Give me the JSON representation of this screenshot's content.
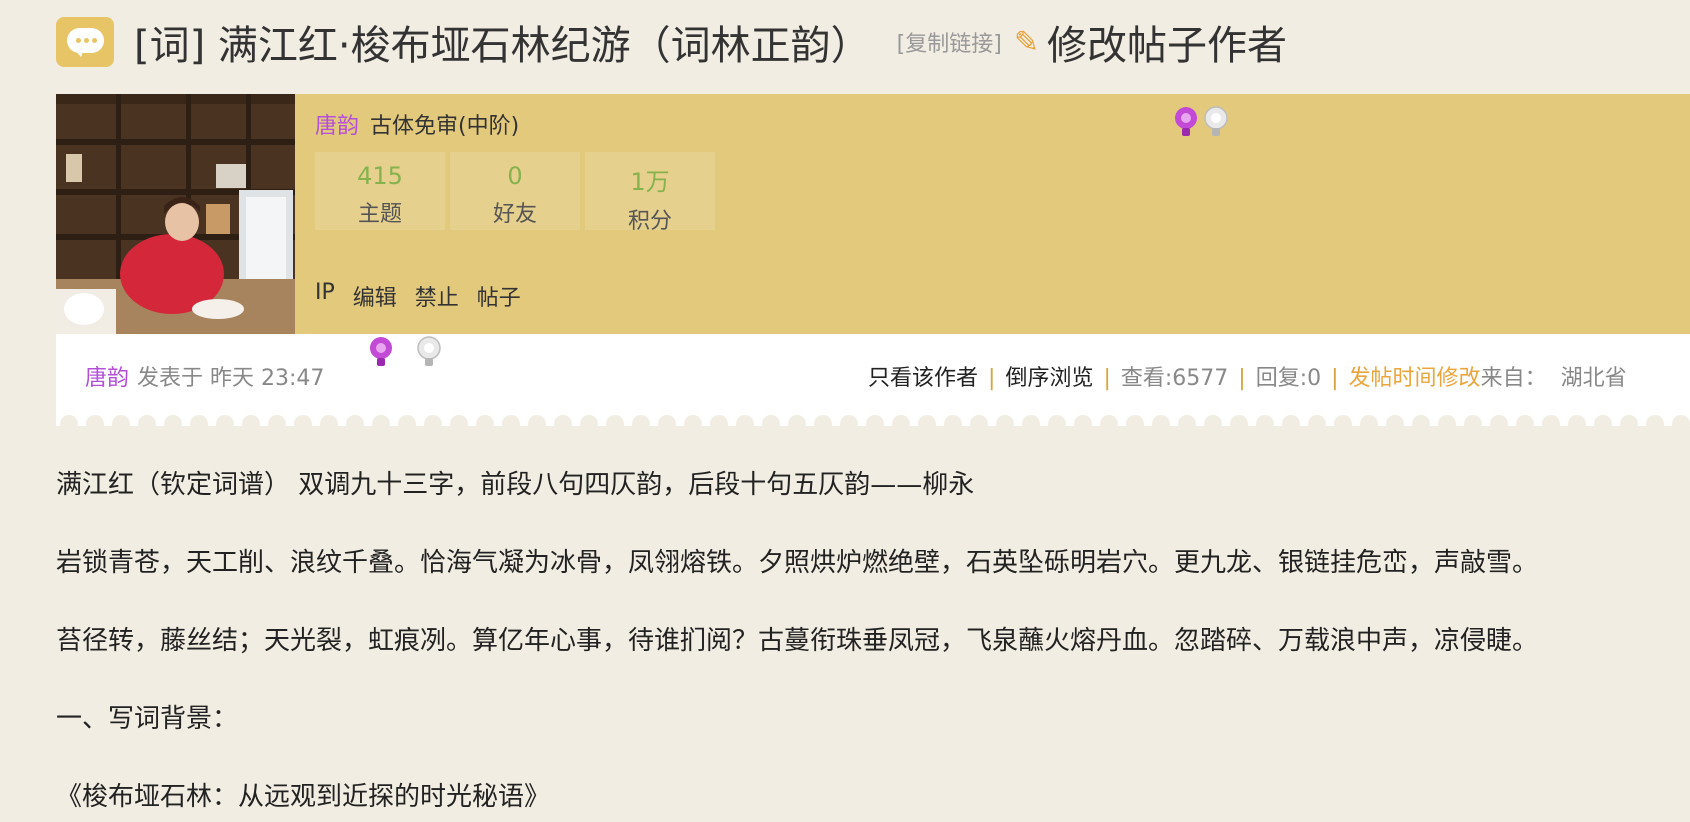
{
  "title": {
    "text": "[词] 满江红·梭布垭石林纪游（词林正韵）",
    "copy_link": "[复制链接]",
    "edit_author": "修改帖子作者"
  },
  "author": {
    "name": "唐韵",
    "rank": "古体免审(中阶)",
    "stats": [
      {
        "value": "415",
        "label": "主题"
      },
      {
        "value": "0",
        "label": "好友"
      },
      {
        "value": "1万",
        "label": "积分"
      }
    ],
    "admin_links": [
      "IP",
      "编辑",
      "禁止",
      "帖子"
    ]
  },
  "meta": {
    "author": "唐韵",
    "posted": "发表于 昨天 23:47",
    "only_author": "只看该作者",
    "reverse": "倒序浏览",
    "views": "查看:6577",
    "replies": "回复:0",
    "modify_time": "发帖时间修改",
    "from_label": "来自：",
    "from_value": "湖北省"
  },
  "content": {
    "lines": [
      "满江红（钦定词谱）     双调九十三字，前段八句四仄韵，后段十句五仄韵——柳永",
      "岩锁青苍，天工削、浪纹千叠。恰海气凝为冰骨，凤翎熔铁。夕照烘炉燃绝壁，石英坠砾明岩穴。更九龙、银链挂危峦，声敲雪。",
      "苔径转，藤丝结；天光裂，虹痕冽。算亿年心事，待谁扪阅？古蔓衔珠垂凤冠，飞泉蘸火熔丹血。忽踏碎、万载浪中声，凉侵睫。",
      "一、写词背景：",
      "《梭布垭石林：从远观到近探的时光秘语》"
    ]
  },
  "colors": {
    "author": "#b44fd8",
    "header_bg": "#e3c97c",
    "stat_value": "#86b24e",
    "separator": "#d8a640",
    "modify_time": "#eaa63c",
    "page_bg": "#f2ede3"
  },
  "icons": [
    "chat-bubble-icon",
    "pencil-icon",
    "purple-medal-icon",
    "silver-medal-icon"
  ]
}
